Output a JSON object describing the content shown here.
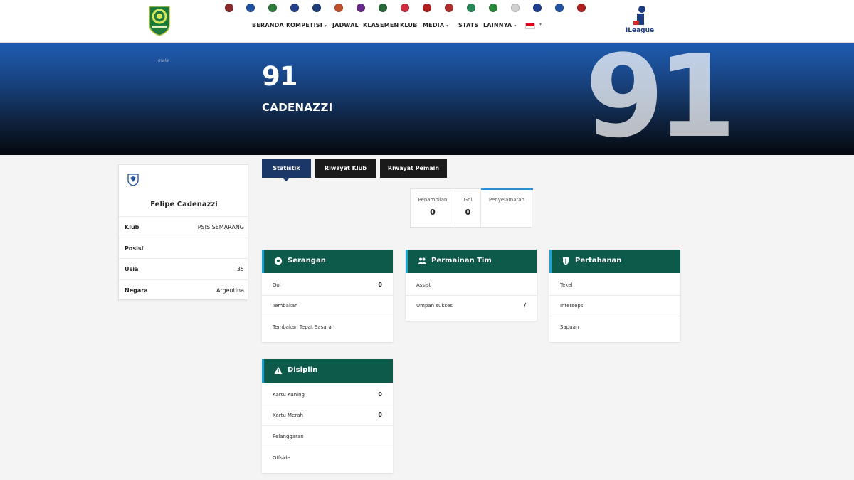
{
  "nav": {
    "items": [
      {
        "label": "BERANDA",
        "dropdown": false
      },
      {
        "label": "KOMPETISI",
        "dropdown": true
      },
      {
        "label": "JADWAL",
        "dropdown": false
      },
      {
        "label": "KLASEMEN",
        "dropdown": false
      },
      {
        "label": "KLUB",
        "dropdown": false
      },
      {
        "label": "MEDIA",
        "dropdown": true
      },
      {
        "label": "STATS",
        "dropdown": false
      },
      {
        "label": "LAINNYA",
        "dropdown": true
      }
    ],
    "caret": "▾",
    "club_logo_colors": [
      "#8a2a2a",
      "#1f4fa0",
      "#2d7a3a",
      "#24408a",
      "#1d3c7a",
      "#c0502a",
      "#6a2a8a",
      "#2a6a3a",
      "#d03040",
      "#b02020",
      "#b03030",
      "#2a8a5a",
      "#2a8a3a",
      "#d0d0d0",
      "#1f3f8f",
      "#2050a0",
      "#b02020"
    ]
  },
  "brand": {
    "ileague": "ILeague",
    "hero_mark": "mala"
  },
  "hero": {
    "number": "91",
    "name": "CADENAZZI",
    "big_number": "91"
  },
  "profile": {
    "name": "Felipe Cadenazzi",
    "rows": [
      {
        "key": "Klub",
        "value": "PSIS SEMARANG"
      },
      {
        "key": "Posisi",
        "value": ""
      },
      {
        "key": "Usia",
        "value": "35"
      },
      {
        "key": "Negara",
        "value": "Argentina"
      }
    ]
  },
  "tabs": [
    {
      "label": "Statistik",
      "active": true
    },
    {
      "label": "Riwayat Klub",
      "active": false
    },
    {
      "label": "Riwayat Pemain",
      "active": false
    }
  ],
  "summary": {
    "cells": [
      {
        "label": "Penampilan",
        "value": "0"
      },
      {
        "label": "Gol",
        "value": "0"
      },
      {
        "label": "Penyelamatan",
        "value": ""
      }
    ]
  },
  "panels": {
    "serangan": {
      "title": "Serangan",
      "icon": "ball-icon",
      "rows": [
        {
          "label": "Gol",
          "value": "0"
        },
        {
          "label": "Tembakan",
          "value": ""
        },
        {
          "label": "Tembakan Tepat Sasaran",
          "value": ""
        }
      ]
    },
    "permainan_tim": {
      "title": "Permainan Tim",
      "icon": "team-icon",
      "rows": [
        {
          "label": "Assist",
          "value": ""
        },
        {
          "label": "Umpan sukses",
          "value": "/"
        }
      ]
    },
    "pertahanan": {
      "title": "Pertahanan",
      "icon": "shield-icon",
      "rows": [
        {
          "label": "Tekel",
          "value": ""
        },
        {
          "label": "Intersepsi",
          "value": ""
        },
        {
          "label": "Sapuan",
          "value": ""
        }
      ]
    },
    "disiplin": {
      "title": "Disiplin",
      "icon": "warning-icon",
      "rows": [
        {
          "label": "Kartu Kuning",
          "value": "0"
        },
        {
          "label": "Kartu Merah",
          "value": "0"
        },
        {
          "label": "Pelanggaran",
          "value": ""
        },
        {
          "label": "Offside",
          "value": ""
        }
      ]
    }
  },
  "colors": {
    "panel_header": "#0e5a4a",
    "panel_accent": "#1aa3d9",
    "tab_active": "#1b3768",
    "tab_inactive": "#1a1a1a"
  }
}
